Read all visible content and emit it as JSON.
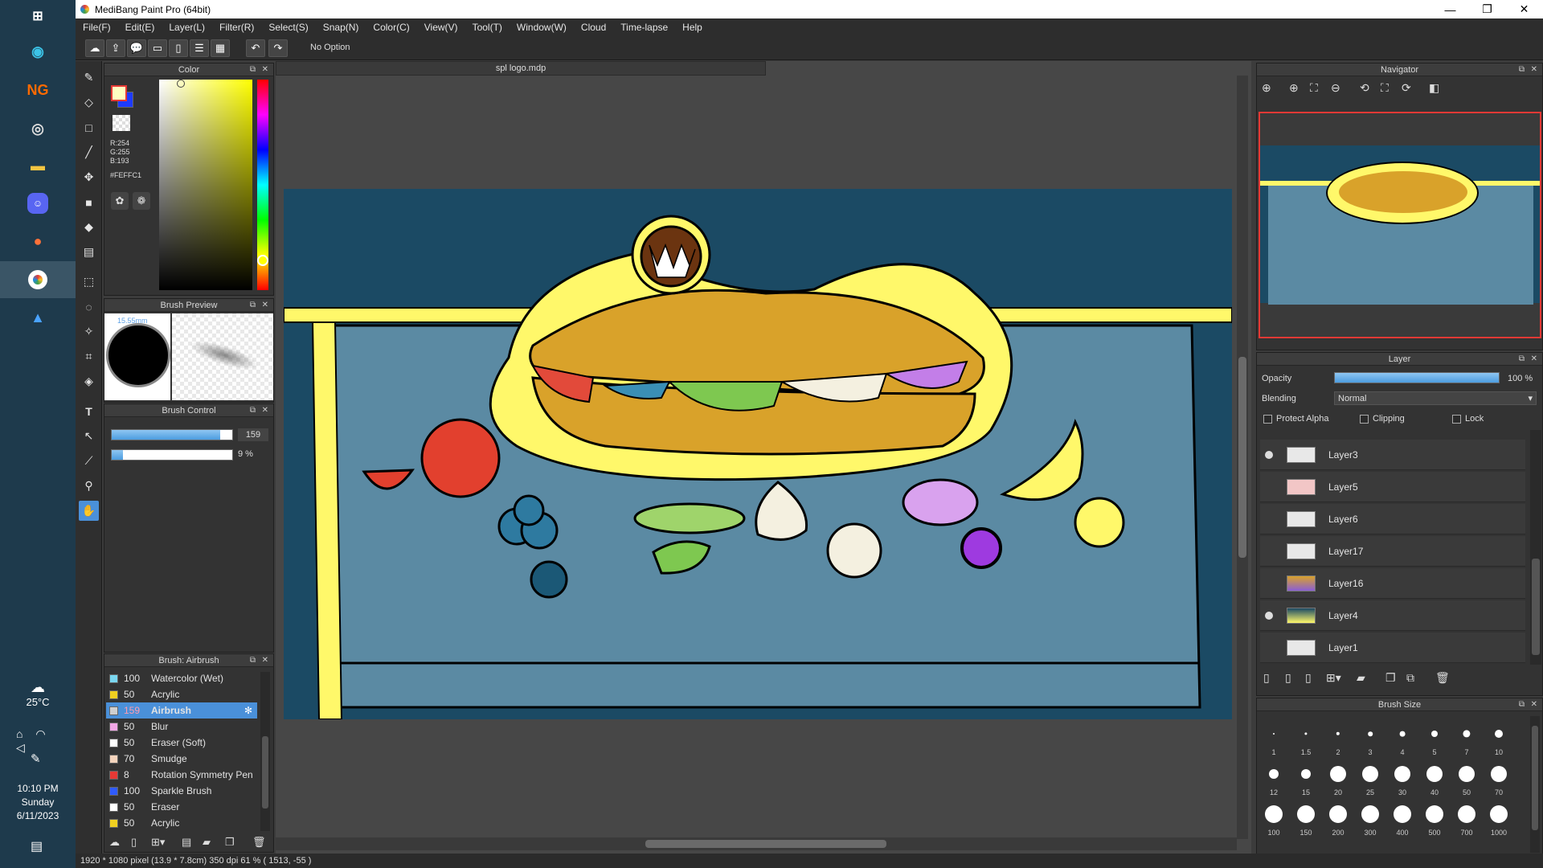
{
  "window": {
    "title": "MediBang Paint Pro (64bit)"
  },
  "menu": [
    "File(F)",
    "Edit(E)",
    "Layer(L)",
    "Filter(R)",
    "Select(S)",
    "Snap(N)",
    "Color(C)",
    "View(V)",
    "Tool(T)",
    "Window(W)",
    "Cloud",
    "Time-lapse",
    "Help"
  ],
  "toolbar": {
    "option_text": "No Option"
  },
  "document": {
    "tab": "spl logo.mdp"
  },
  "color_panel": {
    "title": "Color",
    "r": "R:254",
    "g": "G:255",
    "b": "B:193",
    "hex": "#FEFFC1",
    "fg_color": "#FEFFC1",
    "bg_color": "#1E3BFF"
  },
  "brush_preview": {
    "title": "Brush Preview",
    "size_label": "15.55mm"
  },
  "brush_control": {
    "title": "Brush Control",
    "size": "159",
    "opacity": "9 %",
    "size_fraction": 0.9,
    "opacity_fraction": 0.09
  },
  "brush_list": {
    "title": "Brush: Airbrush",
    "items": [
      {
        "size": "100",
        "name": "Watercolor (Wet)",
        "color": "#7ad7f0"
      },
      {
        "size": "50",
        "name": "Acrylic",
        "color": "#f0d020"
      },
      {
        "size": "159",
        "name": "Airbrush",
        "color": "#cfcfcf",
        "selected": true
      },
      {
        "size": "50",
        "name": "Blur",
        "color": "#f2a6e6"
      },
      {
        "size": "50",
        "name": "Eraser (Soft)",
        "color": "#ffffff"
      },
      {
        "size": "70",
        "name": "Smudge",
        "color": "#f5d4bd"
      },
      {
        "size": "8",
        "name": "Rotation Symmetry Pen",
        "color": "#e53935"
      },
      {
        "size": "100",
        "name": "Sparkle Brush",
        "color": "#2f5bff"
      },
      {
        "size": "50",
        "name": "Eraser",
        "color": "#ffffff"
      },
      {
        "size": "50",
        "name": "Acrylic",
        "color": "#f0d020"
      }
    ]
  },
  "navigator": {
    "title": "Navigator"
  },
  "layer_panel": {
    "title": "Layer",
    "opacity_label": "Opacity",
    "opacity_value": "100 %",
    "blending_label": "Blending",
    "blending_value": "Normal",
    "protect_alpha": "Protect Alpha",
    "clipping": "Clipping",
    "lock": "Lock",
    "layers": [
      {
        "name": "Layer3",
        "visible": true
      },
      {
        "name": "Layer5",
        "visible": false
      },
      {
        "name": "Layer6",
        "visible": false
      },
      {
        "name": "Layer17",
        "visible": false
      },
      {
        "name": "Layer16",
        "visible": false
      },
      {
        "name": "Layer4",
        "visible": true
      },
      {
        "name": "Layer1",
        "visible": false
      }
    ]
  },
  "brush_size": {
    "title": "Brush Size",
    "sizes": [
      "1",
      "1.5",
      "2",
      "3",
      "4",
      "5",
      "7",
      "10",
      "12",
      "15",
      "20",
      "25",
      "30",
      "40",
      "50",
      "70",
      "100",
      "150",
      "200",
      "300",
      "400",
      "500",
      "700",
      "1000"
    ]
  },
  "status": "1920 * 1080 pixel  (13.9 * 7.8cm)  350 dpi  61 %  ( 1513, -55 )",
  "taskbar": {
    "temp": "25°C",
    "time": "10:10 PM",
    "day": "Sunday",
    "date": "6/11/2023"
  }
}
